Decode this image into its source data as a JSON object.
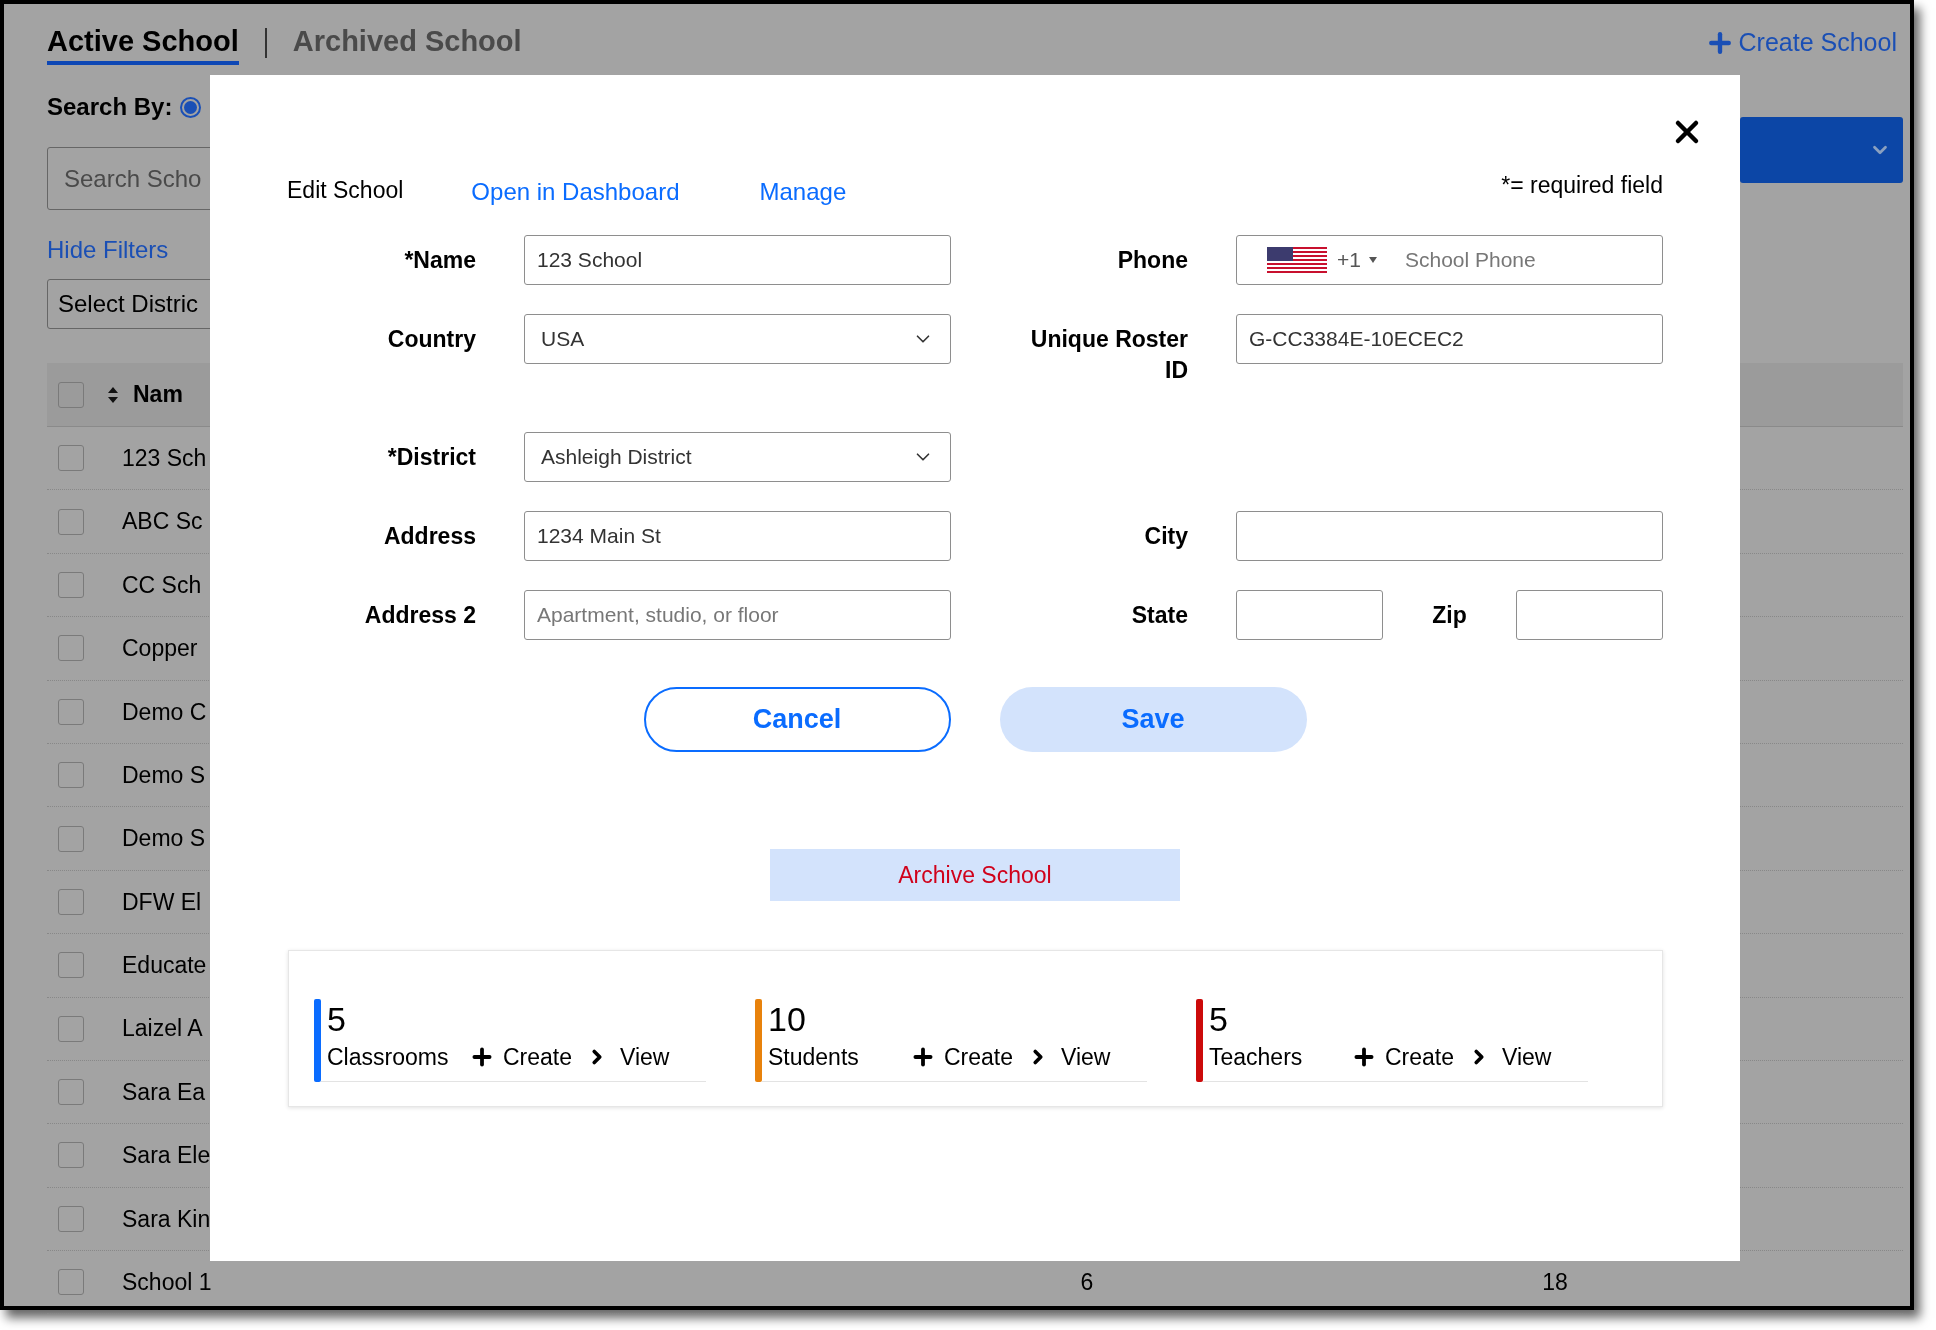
{
  "tabs": [
    {
      "label": "Active School",
      "selected": true
    },
    {
      "label": "Archived School",
      "selected": false
    }
  ],
  "create_button": "Create School",
  "search_by": {
    "label": "Search By:",
    "options": [
      {
        "selected": true
      }
    ]
  },
  "search_field": {
    "placeholder": "Search Scho"
  },
  "hide_filters": "Hide Filters",
  "district_filter": "Select Distric",
  "table": {
    "name_header": "Nam",
    "select_all_checked": false,
    "rows": [
      {
        "name": "123 Sch",
        "checked": false
      },
      {
        "name": "ABC Sc",
        "checked": false
      },
      {
        "name": "CC Sch",
        "checked": false
      },
      {
        "name": "Copper",
        "checked": false
      },
      {
        "name": "Demo C",
        "checked": false
      },
      {
        "name": "Demo S",
        "checked": false
      },
      {
        "name": "Demo S",
        "checked": false
      },
      {
        "name": "DFW El",
        "checked": false
      },
      {
        "name": "Educate",
        "checked": false
      },
      {
        "name": "Laizel A",
        "checked": false
      },
      {
        "name": "Sara Ea",
        "checked": false
      },
      {
        "name": "Sara Ele",
        "checked": false
      },
      {
        "name": "Sara Kin",
        "checked": false
      },
      {
        "name": "School 1",
        "checked": false,
        "cells": [
          "6",
          "18"
        ]
      }
    ]
  },
  "modal": {
    "title": "Edit School",
    "links": [
      "Open in Dashboard",
      "Manage"
    ],
    "required_note": "*= required field",
    "rows": [
      {
        "left": {
          "kind": "text",
          "label": "*Name",
          "value": "123 School"
        },
        "right": {
          "kind": "phone",
          "label": "Phone",
          "code": "+1",
          "placeholder": "School Phone"
        }
      },
      {
        "left": {
          "kind": "select",
          "label": "Country",
          "value": "USA"
        },
        "right": {
          "kind": "text",
          "label": "Unique Roster ID",
          "value": "G-CC3384E-10ECEC2"
        }
      },
      {
        "left": {
          "kind": "select",
          "label": "*District",
          "value": "Ashleigh District"
        }
      },
      {
        "left": {
          "kind": "text",
          "label": "Address",
          "value": "1234 Main St"
        },
        "right": {
          "kind": "text",
          "label": "City"
        }
      },
      {
        "left": {
          "kind": "text",
          "label": "Address 2",
          "placeholder": "Apartment, studio, or floor"
        },
        "right": {
          "kind": "pair",
          "label": "State",
          "second_label": "Zip"
        }
      }
    ],
    "cancel": "Cancel",
    "save": "Save",
    "archive": "Archive School",
    "stats": [
      {
        "count": "5",
        "label": "Classrooms",
        "color": "#0a6cff",
        "create": "Create",
        "view": "View"
      },
      {
        "count": "10",
        "label": "Students",
        "color": "#e8820c",
        "create": "Create",
        "view": "View"
      },
      {
        "count": "5",
        "label": "Teachers",
        "color": "#cc0a0a",
        "create": "Create",
        "view": "View"
      }
    ]
  }
}
